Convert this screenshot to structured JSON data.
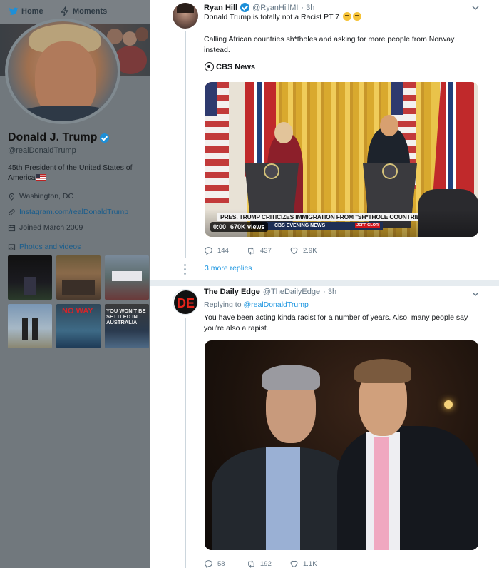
{
  "nav": {
    "home_label": "Home",
    "moments_label": "Moments"
  },
  "profile": {
    "name": "Donald J. Trump",
    "handle": "@realDonaldTrump",
    "bio": "45th President of the United States of America",
    "bio_flag": "us-flag-emoji",
    "location": "Washington, DC",
    "website": "Instagram.com/realDonaldTrump",
    "joined": "Joined March 2009",
    "photos_label": "Photos and videos",
    "photo_thumbs": [
      {
        "caption": ""
      },
      {
        "caption": ""
      },
      {
        "caption": ""
      },
      {
        "caption": ""
      },
      {
        "caption": "NO WAY"
      },
      {
        "caption": "YOU WON'T BE SETTLED IN AUSTRALIA"
      }
    ]
  },
  "tweets": [
    {
      "author": "Ryan Hill",
      "handle": "@RyanHillMI",
      "time": "· 3h",
      "verified": true,
      "text": "Donald Trump is totally not a Racist PT 7",
      "body": "Calling African countries sh*tholes and asking for more people from Norway instead.",
      "emoji": [
        "thinking-face-emoji",
        "thinking-face-emoji"
      ],
      "card_source": "CBS News",
      "video": {
        "chyron": "PRES. TRUMP CRITICIZES IMMIGRATION FROM \"SH*THOLE COUNTRIES\"",
        "program": "CBS EVENING NEWS",
        "reporter_tag": "JEFF GLOR",
        "elapsed": "0:00",
        "views": "670K views"
      },
      "replies": "144",
      "retweets": "437",
      "likes": "2.9K"
    },
    {
      "author": "The Daily Edge",
      "handle": "@TheDailyEdge",
      "time": "· 3h",
      "verified": false,
      "reply_prefix": "Replying to",
      "reply_to": "@realDonaldTrump",
      "text": "You have been acting kinda racist for a number of years. Also, many people say you're also a rapist.",
      "avatar_text": "DE",
      "replies": "58",
      "retweets": "192",
      "likes": "1.1K"
    }
  ],
  "thread": {
    "more_replies": "3 more replies"
  },
  "colors": {
    "accent": "#1b95e0",
    "verified": "#1d8fd8",
    "dim_overlay": "#71787d"
  }
}
